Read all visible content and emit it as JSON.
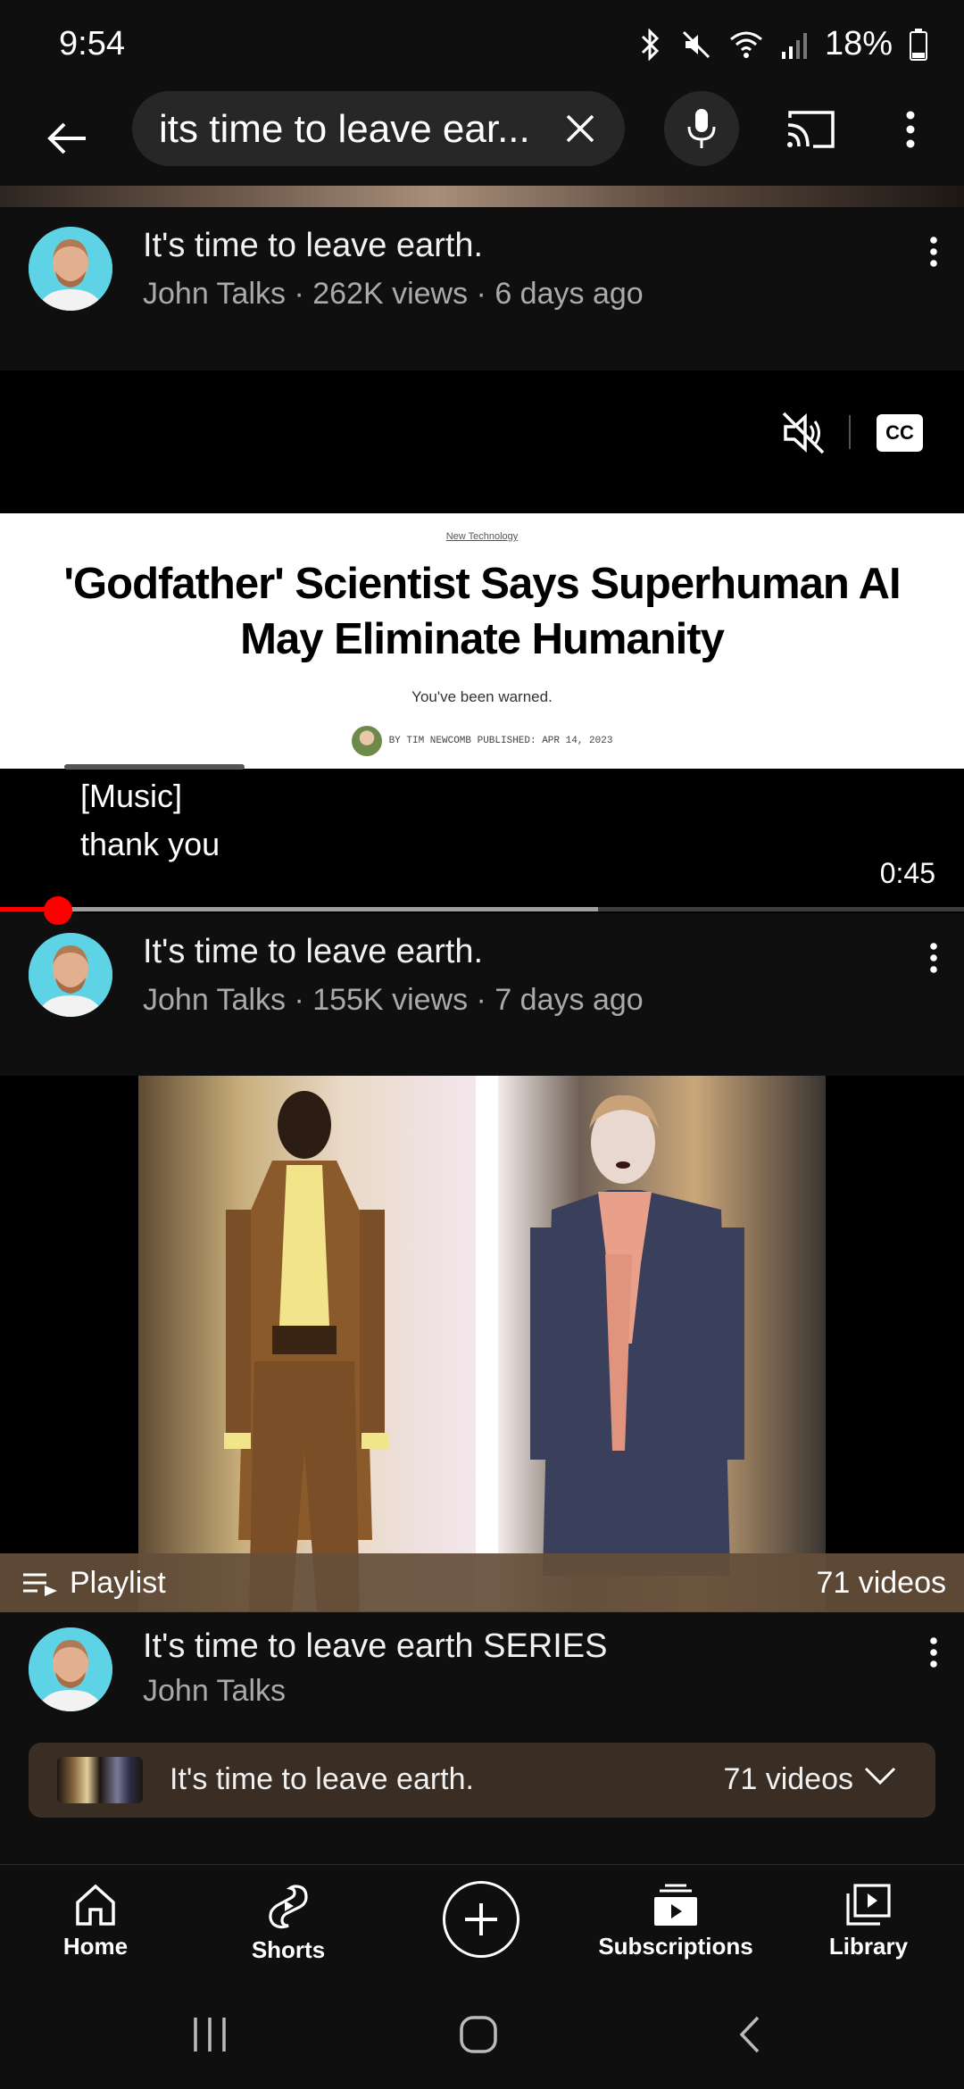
{
  "status_bar": {
    "time": "9:54",
    "battery": "18%"
  },
  "search": {
    "query": "its time to leave ear..."
  },
  "videos": [
    {
      "title": "It's time to leave earth.",
      "channel": "John Talks",
      "meta": "John Talks · 262K views · 6 days ago"
    },
    {
      "title": "It's time to leave earth.",
      "channel": "John Talks",
      "meta": "John Talks · 155K views · 7 days ago"
    }
  ],
  "player": {
    "article_kicker": "New Technology",
    "article_headline": "'Godfather' Scientist Says Superhuman AI May Eliminate Humanity",
    "article_dek": "You've been warned.",
    "article_byline": "BY TIM NEWCOMB   PUBLISHED: APR 14, 2023",
    "caption_line_1": "[Music]",
    "caption_line_2": "thank you",
    "time_remaining": "0:45",
    "cc_label": "CC",
    "progress_played_fraction": 0.06,
    "progress_buffered_fraction": 0.62
  },
  "playlist": {
    "label": "Playlist",
    "count": "71 videos",
    "title": "It's time to leave earth SERIES",
    "channel": "John Talks",
    "chip_title": "It's time to leave earth.",
    "chip_count": "71 videos"
  },
  "bottom_nav": {
    "items": [
      {
        "label": "Home",
        "icon": "home-icon"
      },
      {
        "label": "Shorts",
        "icon": "shorts-icon"
      },
      {
        "label": "",
        "icon": "create-icon"
      },
      {
        "label": "Subscriptions",
        "icon": "subscriptions-icon"
      },
      {
        "label": "Library",
        "icon": "library-icon"
      }
    ]
  },
  "colors": {
    "background": "#0f0f0f",
    "accent_red": "#ff0000",
    "secondary_text": "#aaaaaa",
    "chip_bg": "#3a2e24"
  }
}
